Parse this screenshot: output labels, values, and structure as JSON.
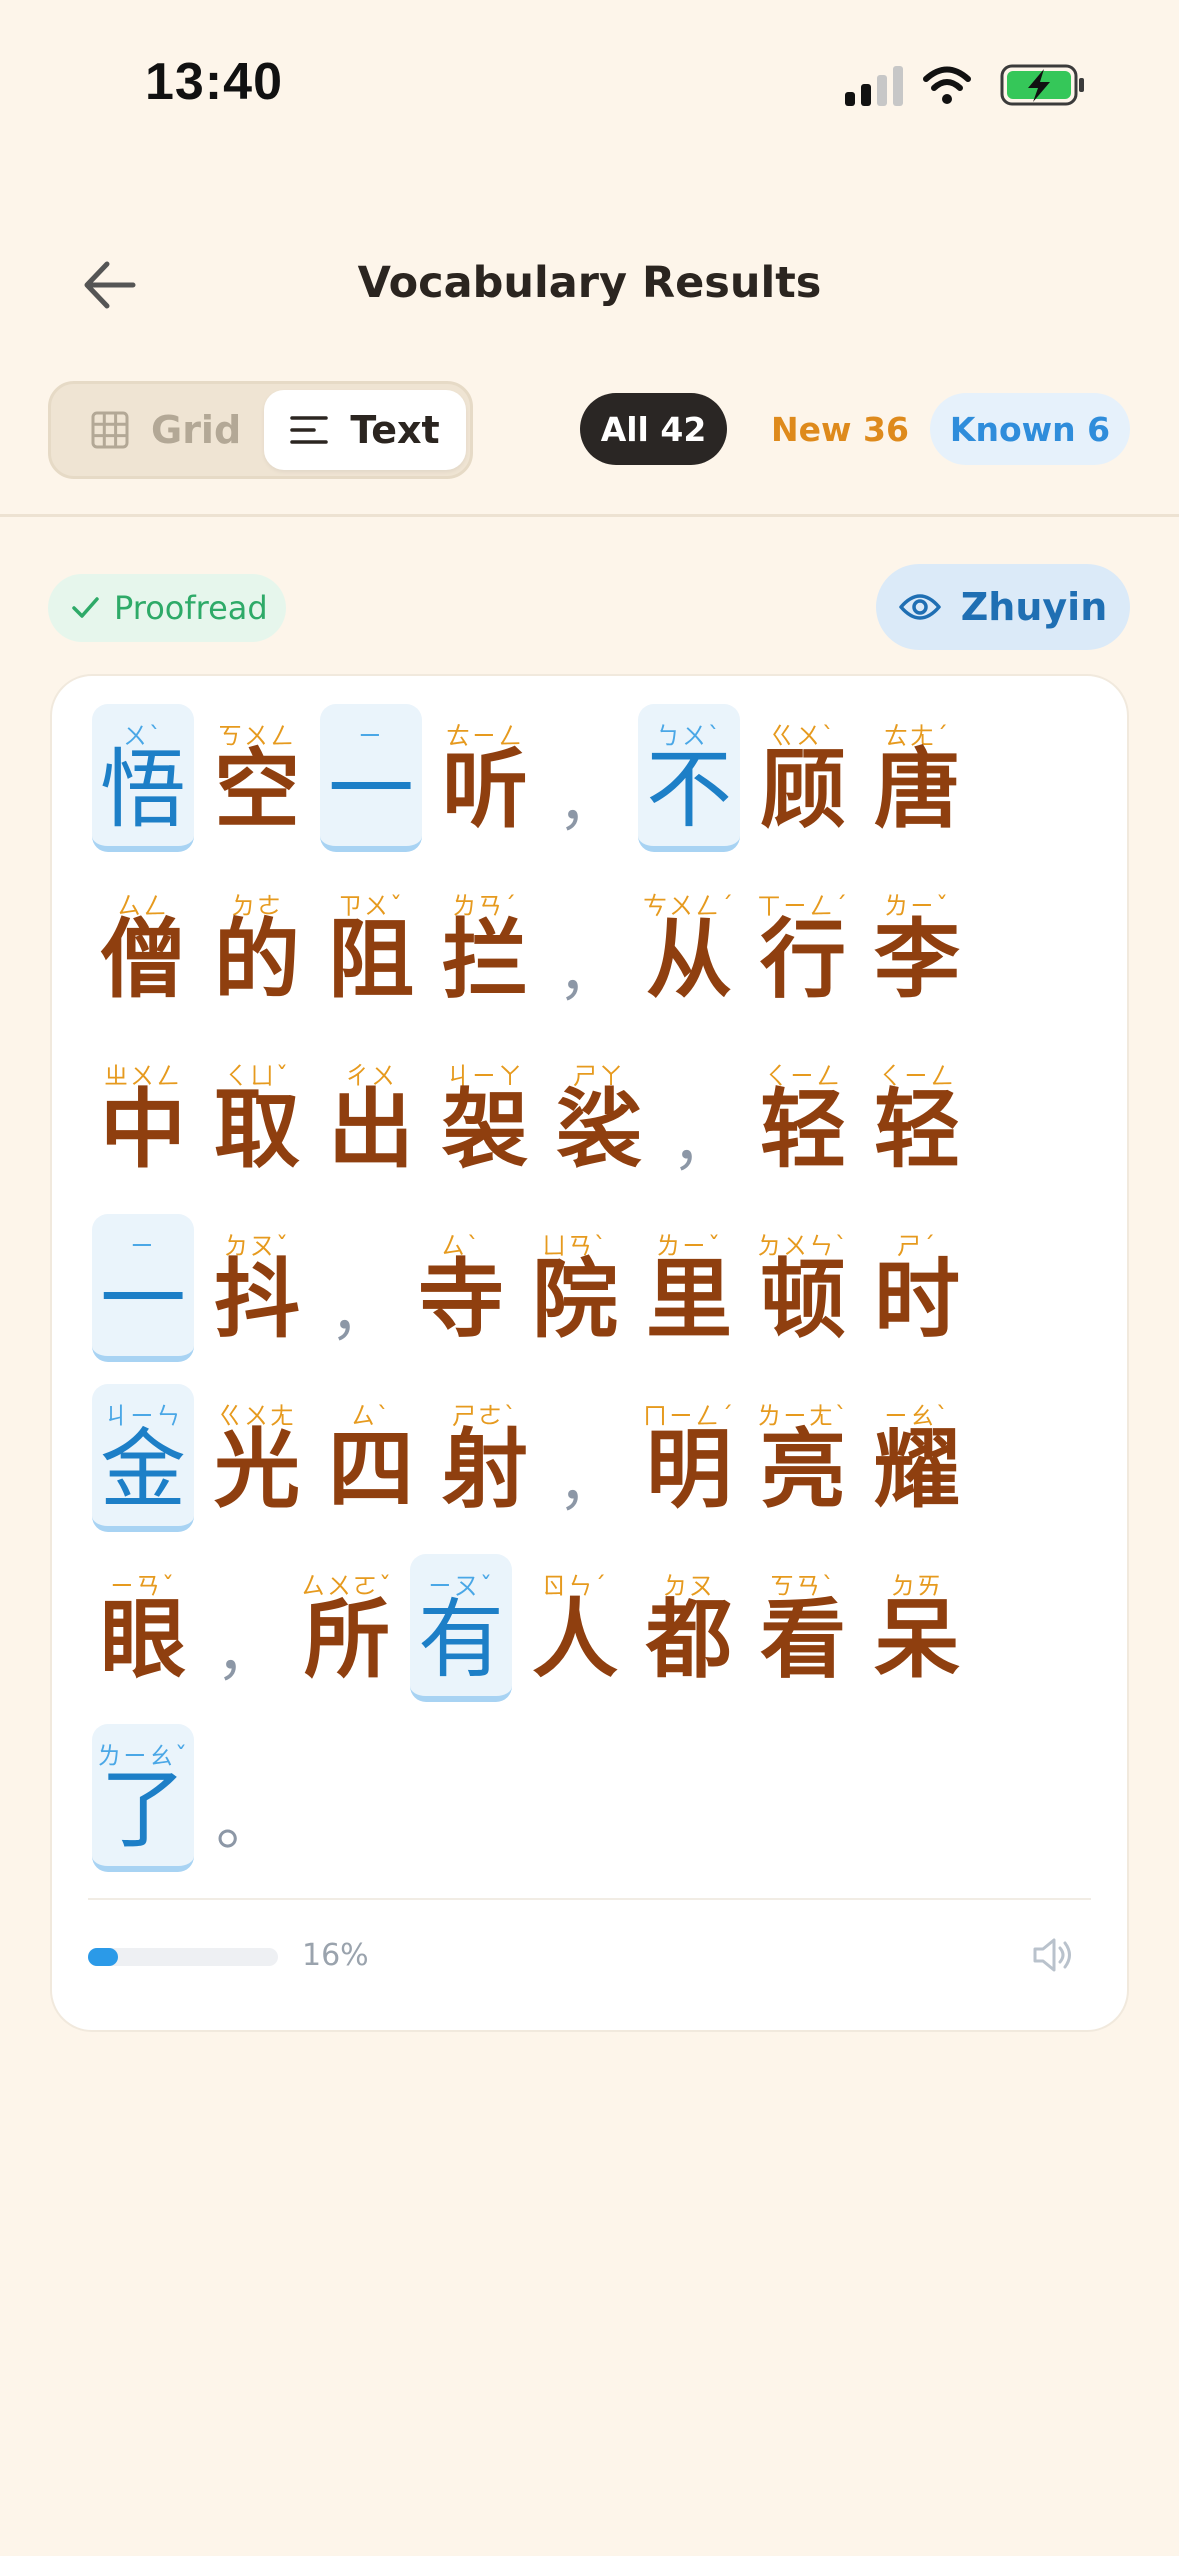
{
  "status_bar": {
    "time": "13:40"
  },
  "header": {
    "title": "Vocabulary Results",
    "back_icon": "arrow-left-icon"
  },
  "view_toggle": {
    "grid_label": "Grid",
    "text_label": "Text",
    "selected": "Text"
  },
  "filters": {
    "all_label": "All",
    "all_count": "42",
    "new_label": "New",
    "new_count": "36",
    "known_label": "Known",
    "known_count": "6",
    "selected": "All"
  },
  "proofread": {
    "label": "Proofread"
  },
  "zhuyin_button": {
    "label": "Zhuyin"
  },
  "passage": {
    "rows": [
      [
        {
          "type": "char",
          "hz": "悟",
          "zy": "ㄨˋ",
          "known": true
        },
        {
          "type": "char",
          "hz": "空",
          "zy": "ㄎㄨㄥ",
          "known": false
        },
        {
          "type": "char",
          "hz": "一",
          "zy": "ㄧ",
          "known": true
        },
        {
          "type": "char",
          "hz": "听",
          "zy": "ㄊㄧㄥ",
          "known": false
        },
        {
          "type": "punc",
          "hz": "，"
        },
        {
          "type": "char",
          "hz": "不",
          "zy": "ㄅㄨˋ",
          "known": true
        },
        {
          "type": "char",
          "hz": "顾",
          "zy": "ㄍㄨˋ",
          "known": false
        },
        {
          "type": "char",
          "hz": "唐",
          "zy": "ㄊㄤˊ",
          "known": false
        }
      ],
      [
        {
          "type": "char",
          "hz": "僧",
          "zy": "ㄙㄥ",
          "known": false
        },
        {
          "type": "char",
          "hz": "的",
          "zy": "ㄉㄜ",
          "known": false
        },
        {
          "type": "char",
          "hz": "阻",
          "zy": "ㄗㄨˇ",
          "known": false
        },
        {
          "type": "char",
          "hz": "拦",
          "zy": "ㄌㄢˊ",
          "known": false
        },
        {
          "type": "punc",
          "hz": "，"
        },
        {
          "type": "char",
          "hz": "从",
          "zy": "ㄘㄨㄥˊ",
          "known": false
        },
        {
          "type": "char",
          "hz": "行",
          "zy": "ㄒㄧㄥˊ",
          "known": false
        },
        {
          "type": "char",
          "hz": "李",
          "zy": "ㄌㄧˇ",
          "known": false
        }
      ],
      [
        {
          "type": "char",
          "hz": "中",
          "zy": "ㄓㄨㄥ",
          "known": false
        },
        {
          "type": "char",
          "hz": "取",
          "zy": "ㄑㄩˇ",
          "known": false
        },
        {
          "type": "char",
          "hz": "出",
          "zy": "ㄔㄨ",
          "known": false
        },
        {
          "type": "char",
          "hz": "袈",
          "zy": "ㄐㄧㄚ",
          "known": false
        },
        {
          "type": "char",
          "hz": "裟",
          "zy": "ㄕㄚ",
          "known": false
        },
        {
          "type": "punc",
          "hz": "，"
        },
        {
          "type": "char",
          "hz": "轻",
          "zy": "ㄑㄧㄥ",
          "known": false
        },
        {
          "type": "char",
          "hz": "轻",
          "zy": "ㄑㄧㄥ",
          "known": false
        }
      ],
      [
        {
          "type": "char",
          "hz": "一",
          "zy": "ㄧ",
          "known": true
        },
        {
          "type": "char",
          "hz": "抖",
          "zy": "ㄉㄡˇ",
          "known": false
        },
        {
          "type": "punc",
          "hz": "，"
        },
        {
          "type": "char",
          "hz": "寺",
          "zy": "ㄙˋ",
          "known": false
        },
        {
          "type": "char",
          "hz": "院",
          "zy": "ㄩㄢˋ",
          "known": false
        },
        {
          "type": "char",
          "hz": "里",
          "zy": "ㄌㄧˇ",
          "known": false
        },
        {
          "type": "char",
          "hz": "顿",
          "zy": "ㄉㄨㄣˋ",
          "known": false
        },
        {
          "type": "char",
          "hz": "时",
          "zy": "ㄕˊ",
          "known": false
        }
      ],
      [
        {
          "type": "char",
          "hz": "金",
          "zy": "ㄐㄧㄣ",
          "known": true
        },
        {
          "type": "char",
          "hz": "光",
          "zy": "ㄍㄨㄤ",
          "known": false
        },
        {
          "type": "char",
          "hz": "四",
          "zy": "ㄙˋ",
          "known": false
        },
        {
          "type": "char",
          "hz": "射",
          "zy": "ㄕㄜˋ",
          "known": false
        },
        {
          "type": "punc",
          "hz": "，"
        },
        {
          "type": "char",
          "hz": "明",
          "zy": "ㄇㄧㄥˊ",
          "known": false
        },
        {
          "type": "char",
          "hz": "亮",
          "zy": "ㄌㄧㄤˋ",
          "known": false
        },
        {
          "type": "char",
          "hz": "耀",
          "zy": "ㄧㄠˋ",
          "known": false
        }
      ],
      [
        {
          "type": "char",
          "hz": "眼",
          "zy": "ㄧㄢˇ",
          "known": false
        },
        {
          "type": "punc",
          "hz": "，"
        },
        {
          "type": "char",
          "hz": "所",
          "zy": "ㄙㄨㄛˇ",
          "known": false
        },
        {
          "type": "char",
          "hz": "有",
          "zy": "ㄧㄡˇ",
          "known": true
        },
        {
          "type": "char",
          "hz": "人",
          "zy": "ㄖㄣˊ",
          "known": false
        },
        {
          "type": "char",
          "hz": "都",
          "zy": "ㄉㄡ",
          "known": false
        },
        {
          "type": "char",
          "hz": "看",
          "zy": "ㄎㄢˋ",
          "known": false
        },
        {
          "type": "char",
          "hz": "呆",
          "zy": "ㄉㄞ",
          "known": false
        }
      ],
      [
        {
          "type": "char",
          "hz": "了",
          "zy": "ㄌㄧㄠˇ",
          "known": true
        },
        {
          "type": "punc",
          "hz": "。"
        }
      ]
    ]
  },
  "playback": {
    "progress_percent": 16,
    "progress_label": "16%",
    "speaker_icon": "speaker-icon"
  },
  "colors": {
    "background": "#fdf5ea",
    "new_char": "#8f3f0f",
    "known_char": "#1d7fc7",
    "zhuyin_new": "#e69a1e",
    "accent_blue": "#2b9ae8"
  }
}
